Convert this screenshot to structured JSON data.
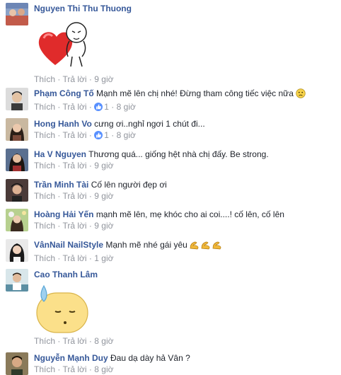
{
  "actions": {
    "like": "Thích",
    "dot": "·",
    "reply": "Trả lời"
  },
  "comments": [
    {
      "author": "Nguyen Thi Thu Thuong",
      "text": "",
      "time": "9 giờ",
      "sticker": "heart-hug-sticker"
    },
    {
      "author": "Phạm Công Tố",
      "text": "Mạnh mẽ lên chị nhé! Đừng tham công tiếc việc nữa",
      "emoji": "sad-face-emoji",
      "likes": "1",
      "time": "8 giờ"
    },
    {
      "author": "Hong Hanh Vo",
      "text": "cưng ơi..nghỉ ngơi 1 chút đi...",
      "likes": "1",
      "time": "8 giờ"
    },
    {
      "author": "Ha V Nguyen",
      "text": "Thương quá... giống hệt nhà chị đấy. Be strong.",
      "time": "9 giờ"
    },
    {
      "author": "Trần Minh Tài",
      "text": "Cố lên người đẹp ơi",
      "time": "9 giờ"
    },
    {
      "author": "Hoàng Hải Yến",
      "text": "mạnh mẽ lên, mẹ khóc cho ai coi....! cố lên, cố lên",
      "time": "9 giờ"
    },
    {
      "author": "VânNail NailStyle",
      "text": "Mạnh mẽ nhé gái yêu",
      "emoji": "flexed-biceps-emoji",
      "time": "1 giờ"
    },
    {
      "author": "Cao Thanh Lâm",
      "text": "",
      "time": "8 giờ",
      "sticker": "sweat-drop-face-sticker"
    },
    {
      "author": "Nguyễn Mạnh Duy",
      "text": "Đau dạ dày hả Vân ?",
      "time": "8 giờ"
    }
  ]
}
